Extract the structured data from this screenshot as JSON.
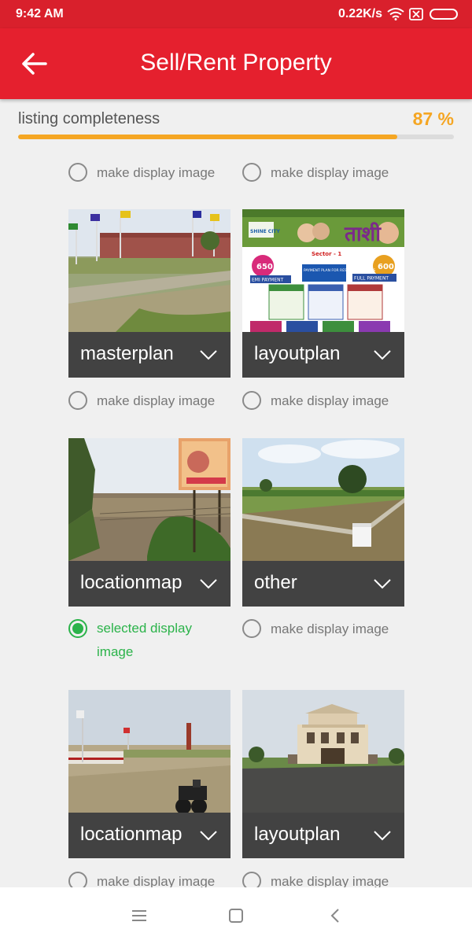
{
  "status_bar": {
    "time": "9:42 AM",
    "net_speed": "0.22K/s"
  },
  "header": {
    "title": "Sell/Rent Property"
  },
  "progress": {
    "label": "listing completeness",
    "percent_text": "87 %",
    "value": 0.87,
    "color": "#f5a623"
  },
  "radio_text": {
    "unselected": "make display image",
    "selected": "selected display image"
  },
  "images": [
    {
      "category": "masterplan"
    },
    {
      "category": "layoutplan"
    },
    {
      "category": "locationmap"
    },
    {
      "category": "other"
    },
    {
      "category": "locationmap"
    },
    {
      "category": "layoutplan"
    }
  ],
  "brochure": {
    "hindi_title": "ताशी",
    "logo_text": "SHINE CITY",
    "left_badge": "650",
    "right_badge": "600",
    "sector": "Sector - 1",
    "emi_label": "EMI PAYMENT",
    "center_label": "PAYMENT PLAN FOR RESIDENTIAL PLOTS",
    "full_label": "FULL PAYMENT"
  },
  "colors": {
    "primary": "#e5202e",
    "status_bar": "#d9202c",
    "accent": "#f5a623",
    "selected_green": "#2bb34a"
  }
}
